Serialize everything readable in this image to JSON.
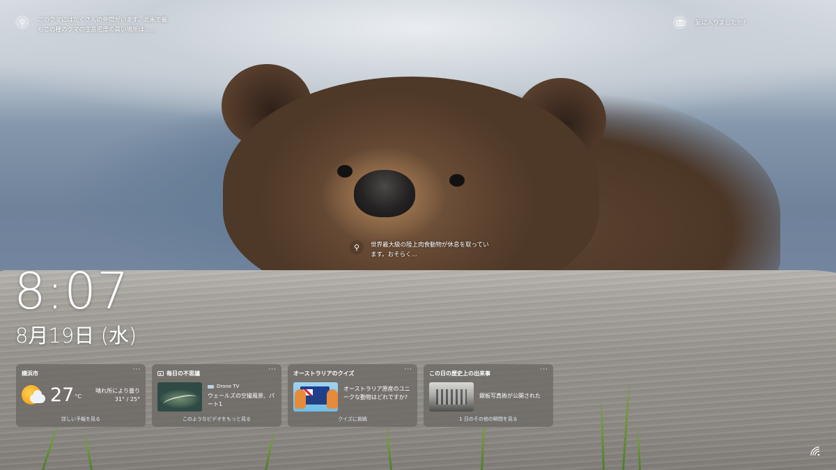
{
  "top_info": {
    "icon": "search-icon",
    "text": "このクマにはたくさんの仲間がいます。北米で最もこの種のクマの生息密度の高い場所は......"
  },
  "like": {
    "icon": "camera-icon",
    "label": "気に入りましたか?"
  },
  "center_info": {
    "icon": "search-icon",
    "text": "世界最大級の陸上肉食動物が休息を取っています。おそらく..."
  },
  "clock": {
    "time": "8:07",
    "date": "8月19日 (水)"
  },
  "widgets": {
    "weather": {
      "title": "横浜市",
      "icon": "partly-cloudy-icon",
      "temperature": "27",
      "unit": "°C",
      "condition": "晴れ所により曇り",
      "range": "31° / 25°",
      "footer": "詳しい予報を見る"
    },
    "wonders": {
      "title": "毎日の不思議",
      "icon": "video-icon",
      "source": "Drone TV",
      "headline": "ウェールズの空撮風景、パート1",
      "footer": "このようなビデオをもっと見る"
    },
    "quiz": {
      "title": "オーストラリアのクイズ",
      "headline": "オーストラリア原産のユニークな動物はどれですか?",
      "footer": "クイズに挑戦"
    },
    "history": {
      "title": "この日の歴史上の出来事",
      "headline": "銀板写真術が公開された",
      "footer": "1 日のその他の瞬間を見る"
    },
    "more_label": "···"
  },
  "system": {
    "network_icon": "wifi-icon"
  },
  "colors": {
    "widget_bg": "#6c6864",
    "link": "#dfeaf3",
    "sun": "#f6a21b"
  }
}
